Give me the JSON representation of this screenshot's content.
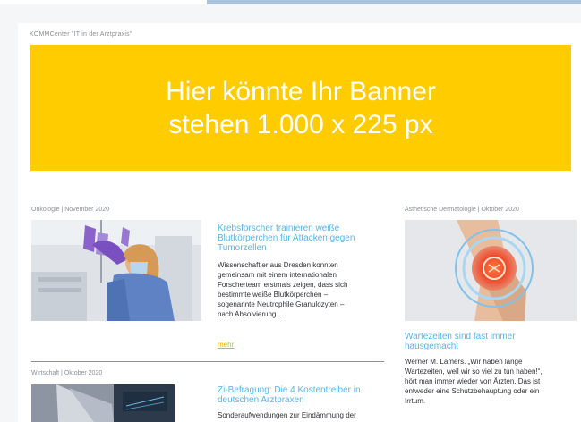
{
  "header": {
    "kicker": "KOMMCenter \"IT in der Arztpraxis\""
  },
  "banner": {
    "line1": "Hier könnte Ihr Banner",
    "line2": "stehen 1.000 x 225 px",
    "color": "#ffcc00"
  },
  "articles": [
    {
      "meta": "Onkologie | November 2020",
      "title_lines": [
        "Krebsforscher trainieren weiße",
        "Blutkörperchen für Attacken gegen",
        "Tumorzellen"
      ],
      "teaser_lines": [
        "Wissenschaftler aus Dresden konnten",
        "gemeinsam mit einem internationalen",
        "Forscherteam erstmals zeigen, dass sich",
        "bestimmte weiße Blutkörperchen –",
        "sogenannte Neutrophile Granulozyten –",
        "nach Absolvierung…"
      ],
      "more_label": "mehr"
    },
    {
      "meta": "Wirtschaft | Oktober 2020",
      "title_lines": [
        "Zi-Befragung: Die 4 Kostentreiber in",
        "deutschen Arztpraxen"
      ],
      "teaser_lines": [
        "Sonderaufwendungen zur Eindämmung der"
      ]
    },
    {
      "meta": "Ästhetische Dermatologie | Oktober 2020",
      "title_lines": [
        "Wartezeiten sind fast immer",
        "hausgemacht"
      ],
      "teaser_lines": [
        "Werner M. Lamers. „Wir haben lange",
        "Wartezeiten, weil wir so viel zu tun haben!“,",
        "hört man immer wieder von Ärzten. Das ist",
        "entweder eine Schutzbehauptung oder ein",
        "Irrtum."
      ]
    }
  ],
  "colors": {
    "headline": "#58b5e7",
    "link": "#f0b400",
    "accent_strip": "#a9c3db"
  }
}
